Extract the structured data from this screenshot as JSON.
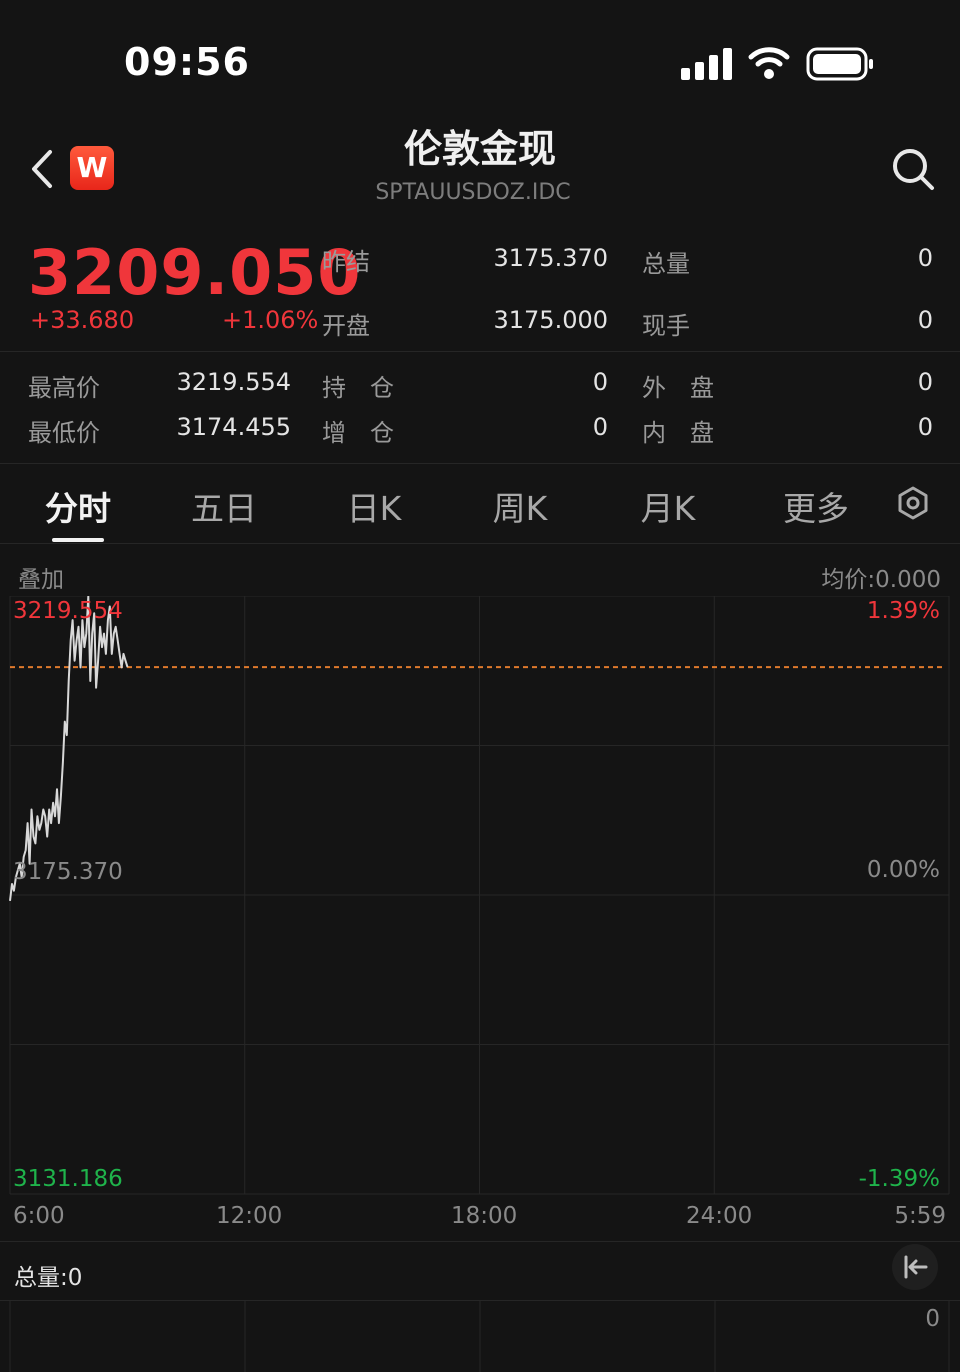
{
  "status_bar": {
    "time": "09:56"
  },
  "header": {
    "logo_letter": "W",
    "title": "伦敦金现",
    "code": "SPTAUUSDOZ.IDC"
  },
  "quote": {
    "price": "3209.050",
    "change": "+33.680",
    "change_pct": "+1.06%",
    "fields": [
      {
        "label": "昨结",
        "value": "3175.370"
      },
      {
        "label": "总量",
        "value": "0"
      },
      {
        "label": "开盘",
        "value": "3175.000"
      },
      {
        "label": "现手",
        "value": "0"
      },
      {
        "label": "最高价",
        "value": "3219.554"
      },
      {
        "label": "持　仓",
        "value": "0"
      },
      {
        "label": "外　盘",
        "value": "0"
      },
      {
        "label": "最低价",
        "value": "3174.455"
      },
      {
        "label": "增　仓",
        "value": "0"
      },
      {
        "label": "内　盘",
        "value": "0"
      }
    ]
  },
  "tabs": [
    "分时",
    "五日",
    "日K",
    "周K",
    "月K",
    "更多"
  ],
  "active_tab": "分时",
  "chart": {
    "overlay_label": "叠加",
    "avg_price": "均价:0.000",
    "y_high": "3219.554",
    "y_mid": "3175.370",
    "y_low": "3131.186",
    "pct_high": "1.39%",
    "pct_mid": "0.00%",
    "pct_low": "-1.39%",
    "time_labels": [
      "6:00",
      "12:00",
      "18:00",
      "24:00",
      "5:59"
    ],
    "volume_label": "总量:0",
    "volume_axis": "0",
    "colors": {
      "up": "#f0363b",
      "down": "#1fb34b",
      "line": "#d8d8d8",
      "current_price_line": "#e07a2c"
    }
  },
  "chart_data": {
    "type": "line",
    "title": "",
    "xlabel": "",
    "ylabel": "",
    "x_ticks": [
      "6:00",
      "12:00",
      "18:00",
      "24:00",
      "5:59"
    ],
    "ylim": [
      3131.186,
      3219.554
    ],
    "prev_settle": 3175.37,
    "current_price": 3209.05,
    "grid": true,
    "series": [
      {
        "x_minutes_from_6_00": [
          0,
          3,
          6,
          9,
          12,
          15,
          18,
          21,
          24,
          27,
          30,
          33,
          36,
          39,
          42,
          45,
          48,
          51,
          54,
          57,
          60,
          63,
          66,
          69,
          72,
          75,
          78,
          81,
          84,
          87,
          90,
          93,
          96,
          99,
          102,
          105,
          108,
          111,
          114,
          117,
          120,
          123,
          126,
          129,
          132,
          135,
          138,
          141,
          144,
          147,
          150,
          153,
          156,
          159,
          162,
          165,
          168,
          171,
          174,
          177,
          180
        ],
        "values": [
          3174.5,
          3177,
          3176,
          3178,
          3179,
          3180,
          3178,
          3181,
          3182,
          3186,
          3180,
          3188,
          3184,
          3183,
          3187,
          3185,
          3186,
          3188,
          3187,
          3184,
          3188,
          3186,
          3189,
          3187,
          3191,
          3186,
          3190,
          3195,
          3201,
          3199,
          3207,
          3213,
          3216,
          3210,
          3213,
          3215,
          3209,
          3216,
          3212,
          3214,
          3219.5,
          3207,
          3214,
          3217,
          3206,
          3210,
          3215,
          3212,
          3214,
          3211,
          3216,
          3218,
          3211,
          3214,
          3215,
          3213,
          3211,
          3209,
          3211,
          3210,
          3209.05
        ]
      }
    ]
  }
}
